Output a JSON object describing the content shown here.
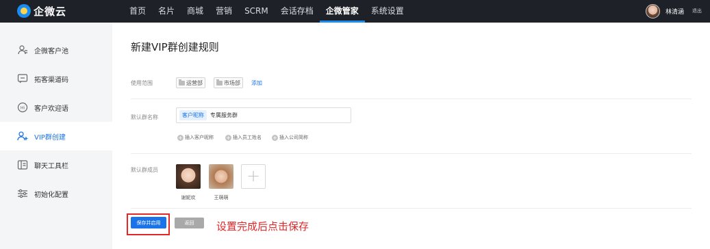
{
  "app": {
    "logo_text": "企微云"
  },
  "nav": {
    "items": [
      "首页",
      "名片",
      "商城",
      "营销",
      "SCRM",
      "会话存档",
      "企微管家",
      "系统设置"
    ],
    "active_index": 6
  },
  "user": {
    "name": "林清涵",
    "logout": "退出"
  },
  "sidebar": {
    "items": [
      {
        "label": "企微客户池",
        "icon": "user-pool-icon"
      },
      {
        "label": "拓客渠道码",
        "icon": "message-square-icon"
      },
      {
        "label": "客户欢迎语",
        "icon": "hi-bubble-icon"
      },
      {
        "label": "VIP群创建",
        "icon": "group-add-icon"
      },
      {
        "label": "聊天工具栏",
        "icon": "sidebar-panel-icon"
      },
      {
        "label": "初始化配置",
        "icon": "sliders-icon"
      }
    ],
    "active_index": 3
  },
  "main": {
    "title": "新建VIP群创建规则",
    "scope": {
      "label": "使用范围",
      "tags": [
        "运营部",
        "市场部"
      ],
      "add_link": "添加"
    },
    "group_name": {
      "label": "默认群名称",
      "chip": "客户昵称",
      "value": "专属服务群",
      "inserts": [
        "插入客户昵称",
        "插入员工姓名",
        "插入公司简称"
      ]
    },
    "members": {
      "label": "默认群成员",
      "list": [
        {
          "name": "谢妮欢"
        },
        {
          "name": "王萌萌"
        }
      ]
    },
    "buttons": {
      "save": "保存并启用",
      "back": "返回"
    },
    "annotation": "设置完成后点击保存"
  },
  "colors": {
    "accent": "#1a73e8",
    "topbar": "#1e2228",
    "sidebar_bg": "#f4f5f7",
    "annotation": "#e32626"
  }
}
